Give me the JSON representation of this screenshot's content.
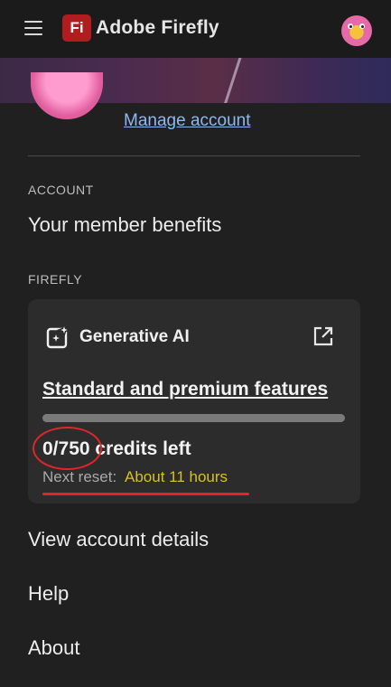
{
  "header": {
    "menu_icon": "hamburger-menu-icon",
    "logo_text": "Fi",
    "app_title": "Adobe Firefly",
    "avatar_icon": "user-avatar"
  },
  "profile": {
    "manage_account": "Manage account"
  },
  "account_section": {
    "label": "ACCOUNT",
    "member_benefits": "Your member benefits"
  },
  "firefly_section": {
    "label": "FIREFLY",
    "card": {
      "icon": "generative-ai-sparkle-icon",
      "title": "Generative AI",
      "external_icon": "external-link-icon",
      "features_link": "Standard and premium features",
      "progress_fraction": 0,
      "credits_count": "0/750",
      "credits_suffix": " credits left",
      "reset_label": "Next reset:",
      "reset_value": "About 11 hours"
    }
  },
  "menu": {
    "view_account_details": "View account details",
    "help": "Help",
    "about": "About"
  },
  "colors": {
    "annotation_red": "#e0262b",
    "reset_highlight": "#d7c21f",
    "link_blue": "#8db8f0",
    "logo_red": "#b11c1f"
  }
}
